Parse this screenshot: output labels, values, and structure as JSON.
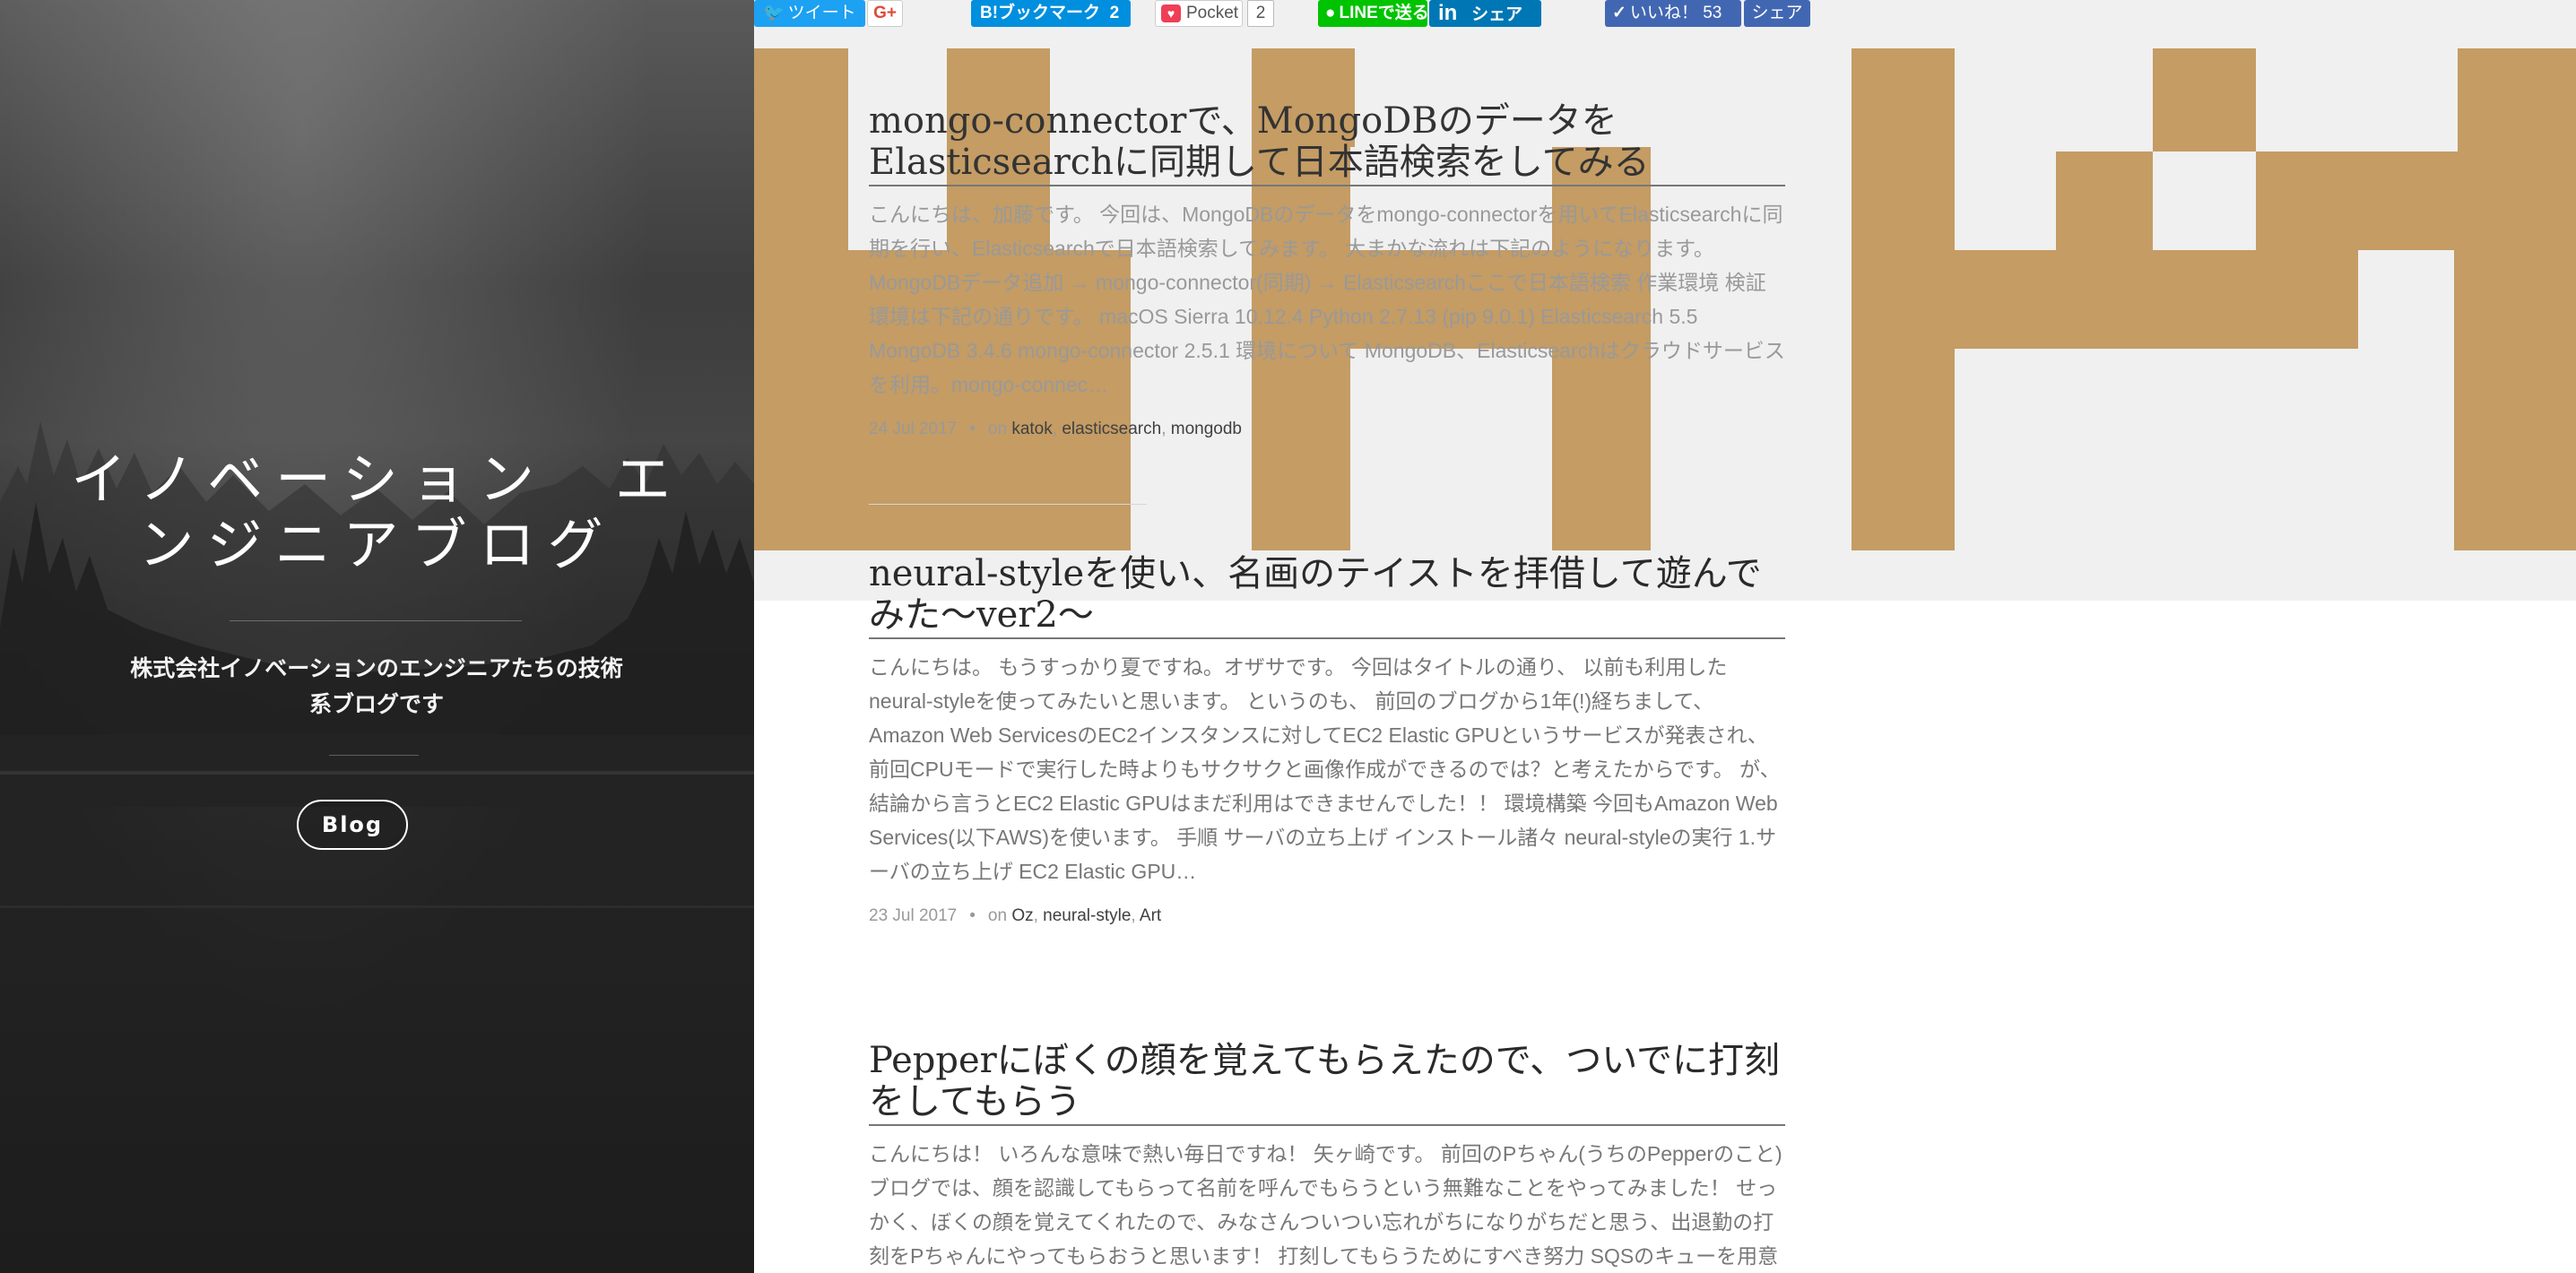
{
  "sidebar": {
    "site_title": "イノベーション　エンジニアブログ",
    "description": "株式会社イノベーションのエンジニアたちの技術系ブログです",
    "blog_button": "Blog"
  },
  "share_bar": {
    "tweet": "ツイート",
    "google_plus": "G+",
    "hatena": "B!ブックマーク",
    "hatena_count": "2",
    "pocket": "Pocket",
    "pocket_count": "2",
    "line": "LINEで送る",
    "linkedin": "in",
    "linkedin_share": "シェア",
    "fb_like": "いいね！",
    "fb_like_count": "53",
    "fb_share": "シェア"
  },
  "posts": [
    {
      "title": "mongo-connectorで、MongoDBのデータをElasticsearchに同期して日本語検索をしてみる",
      "excerpt": "こんにちは、加藤です。 今回は、MongoDBのデータをmongo-connectorを用いてElasticsearchに同期を行い、Elasticsearchで日本語検索してみます。 大まかな流れは下記のようになります。 MongoDBデータ追加 → mongo-connector(同期) → Elasticsearchここで日本語検索 作業環境 検証環境は下記の通りです。 macOS Sierra 10.12.4 Python 2.7.13 (pip 9.0.1) Elasticsearch 5.5 MongoDB 3.4.6 mongo-connector 2.5.1 環境について MongoDB、Elasticsearchはクラウドサービスを利用。mongo-connec…",
      "date": "24 Jul 2017",
      "on": "on",
      "tags": [
        "katok",
        "elasticsearch",
        "mongodb"
      ]
    },
    {
      "title": "neural-styleを使い、名画のテイストを拝借して遊んでみた〜ver2〜",
      "excerpt": "こんにちは。 もうすっかり夏ですね。オザサです。 今回はタイトルの通り、 以前も利用したneural-styleを使ってみたいと思います。 というのも、 前回のブログから1年(!)経ちまして、Amazon Web ServicesのEC2インスタンスに対してEC2 Elastic GPUというサービスが発表され、前回CPUモードで実行した時よりもサクサクと画像作成ができるのでは？と考えたからです。 が、結論から言うとEC2 Elastic GPUはまだ利用はできませんでした！！ 環境構築 今回もAmazon Web Services(以下AWS)を使います。 手順 サーバの立ち上げ インストール諸々 neural-styleの実行 1.サーバの立ち上げ EC2 Elastic GPU…",
      "date": "23 Jul 2017",
      "on": "on",
      "tags": [
        "Oz",
        "neural-style",
        "Art"
      ]
    },
    {
      "title": "Pepperにぼくの顔を覚えてもらえたので、ついでに打刻をしてもらう",
      "excerpt": "こんにちは！ いろんな意味で熱い毎日ですね！ 矢ヶ崎です。 前回のPちゃん(うちのPepperのこと)ブログでは、顔を認識してもらって名前を呼んでもらうという無難なことをやってみました！ せっかく、ぼくの顔を覚えてくれたので、みなさんついつい忘れがちになりがちだと思う、出退勤の打刻をPちゃんにやってもらおうと思います！ 打刻してもらうためにすべき努力 SQSのキューを用意"
    }
  ],
  "colors": {
    "pattern_gold": "#c49c64",
    "hero_bg": "#f0f0f0"
  }
}
